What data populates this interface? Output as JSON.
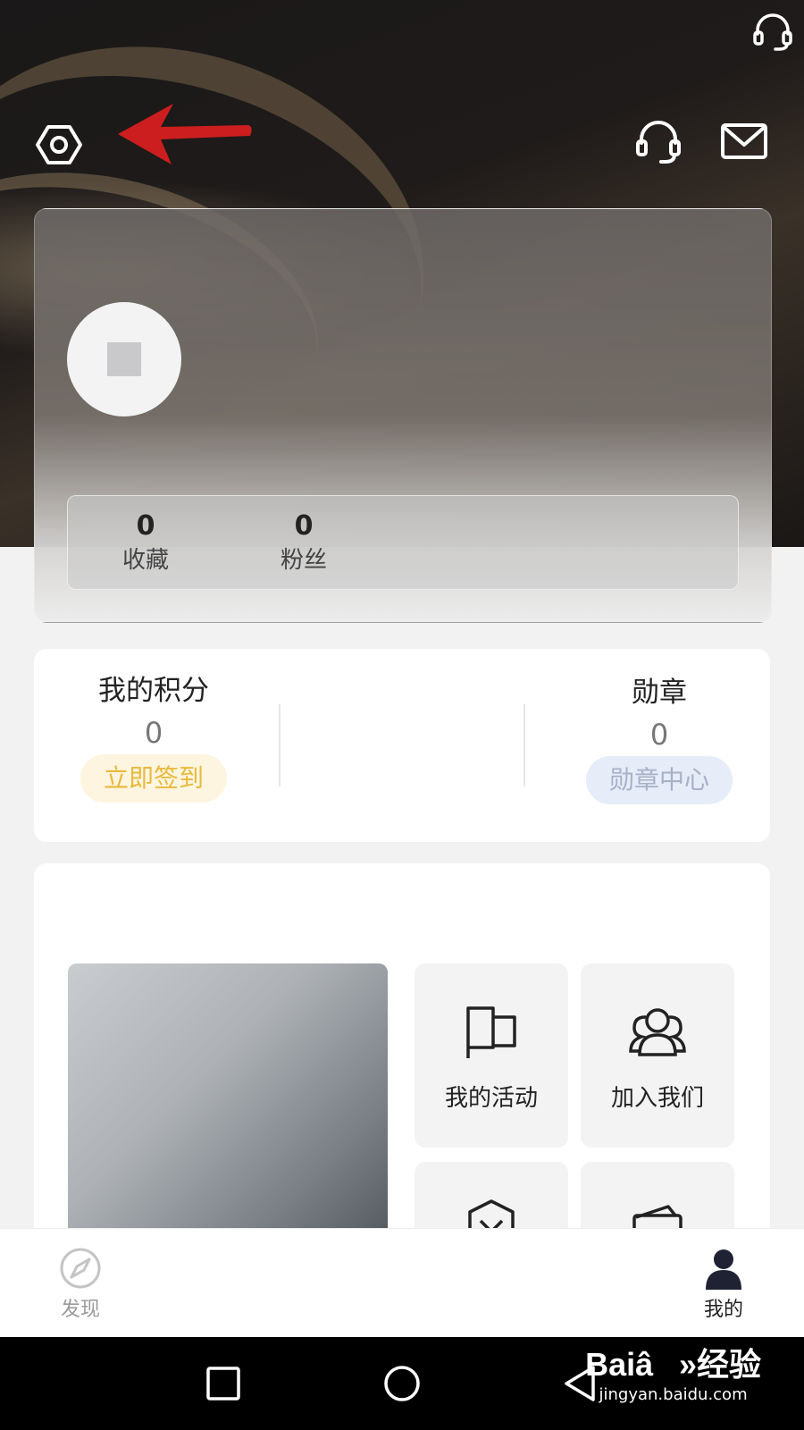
{
  "stats": [
    {
      "value": "0",
      "label": "收藏"
    },
    {
      "value": "0",
      "label": "粉丝"
    }
  ],
  "points": {
    "title": "我的积分",
    "value": "0",
    "checkin_label": "立即签到"
  },
  "medals": {
    "title": "勋章",
    "value": "0",
    "center_label": "勋章中心"
  },
  "menu": {
    "tiles": [
      {
        "label": "我的活动",
        "icon": "flag-icon"
      },
      {
        "label": "加入我们",
        "icon": "group-icon"
      }
    ]
  },
  "nav": {
    "discover_label": "发现",
    "mine_label": "我的"
  },
  "watermark": {
    "brand": "Baiâ»经验",
    "url": "jingyan.baidu.com"
  },
  "colors": {
    "checkin_text": "#e8b93c",
    "checkin_bg": "#fdf5df",
    "medal_text": "#a7b1c7",
    "medal_bg": "#e6ecf8",
    "arrow": "#cc1e1e"
  }
}
